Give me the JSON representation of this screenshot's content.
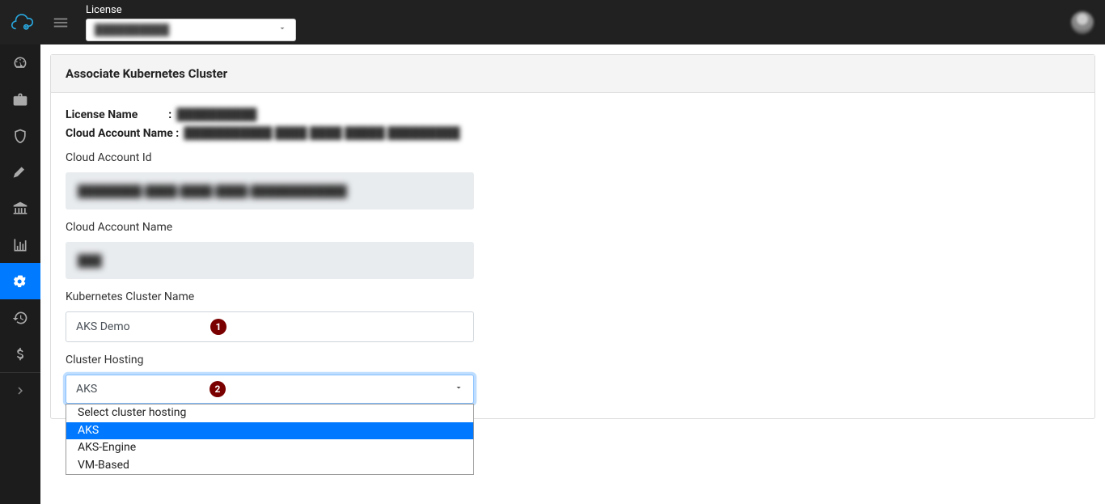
{
  "topbar": {
    "license_label": "License",
    "license_value": "██████████"
  },
  "sidebar": {
    "items": [
      {
        "name": "dashboard",
        "icon": "gauge"
      },
      {
        "name": "accounts",
        "icon": "briefcase"
      },
      {
        "name": "security",
        "icon": "shield"
      },
      {
        "name": "tools",
        "icon": "pin"
      },
      {
        "name": "compliance",
        "icon": "institution"
      },
      {
        "name": "reports",
        "icon": "bar-chart"
      },
      {
        "name": "settings",
        "icon": "gears",
        "active": true
      },
      {
        "name": "history",
        "icon": "history"
      },
      {
        "name": "billing",
        "icon": "dollar"
      }
    ]
  },
  "page": {
    "title": "Associate Kubernetes Cluster",
    "license_name_label": "License Name",
    "license_name_value": "██████████",
    "cloud_account_name_label": "Cloud Account Name :",
    "cloud_account_name_value": "███████████ ████ ████ █████ █████████",
    "cloud_account_id_label": "Cloud Account Id",
    "cloud_account_id_value": "████████-████-████-████-████████████",
    "cloud_account_name_field_label": "Cloud Account Name",
    "cloud_account_name_field_value": "███",
    "k8s_name_label": "Kubernetes Cluster Name",
    "k8s_name_value": "AKS Demo",
    "hosting_label": "Cluster Hosting",
    "hosting_selected": "AKS",
    "hosting_options": [
      "Select cluster hosting",
      "AKS",
      "AKS-Engine",
      "VM-Based"
    ]
  },
  "annotations": {
    "1": "1",
    "2": "2"
  }
}
